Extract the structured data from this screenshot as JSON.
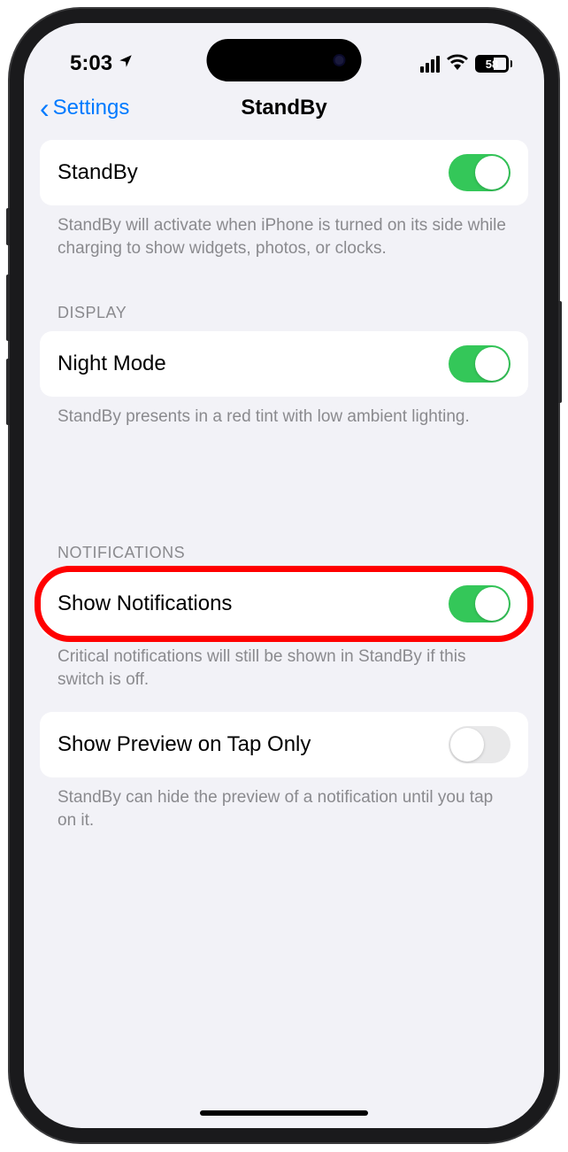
{
  "status_bar": {
    "time": "5:03",
    "battery_percent": "58"
  },
  "nav": {
    "back_label": "Settings",
    "title": "StandBy"
  },
  "sections": {
    "standby": {
      "label": "StandBy",
      "toggle_on": true,
      "footer": "StandBy will activate when iPhone is turned on its side while charging to show widgets, photos, or clocks."
    },
    "display": {
      "header": "DISPLAY",
      "night_mode": {
        "label": "Night Mode",
        "toggle_on": true
      },
      "footer": "StandBy presents in a red tint with low ambient lighting."
    },
    "notifications": {
      "header": "NOTIFICATIONS",
      "show_notifications": {
        "label": "Show Notifications",
        "toggle_on": true
      },
      "show_notifications_footer": "Critical notifications will still be shown in StandBy if this switch is off.",
      "show_preview": {
        "label": "Show Preview on Tap Only",
        "toggle_on": false
      },
      "show_preview_footer": "StandBy can hide the preview of a notification until you tap on it."
    }
  }
}
